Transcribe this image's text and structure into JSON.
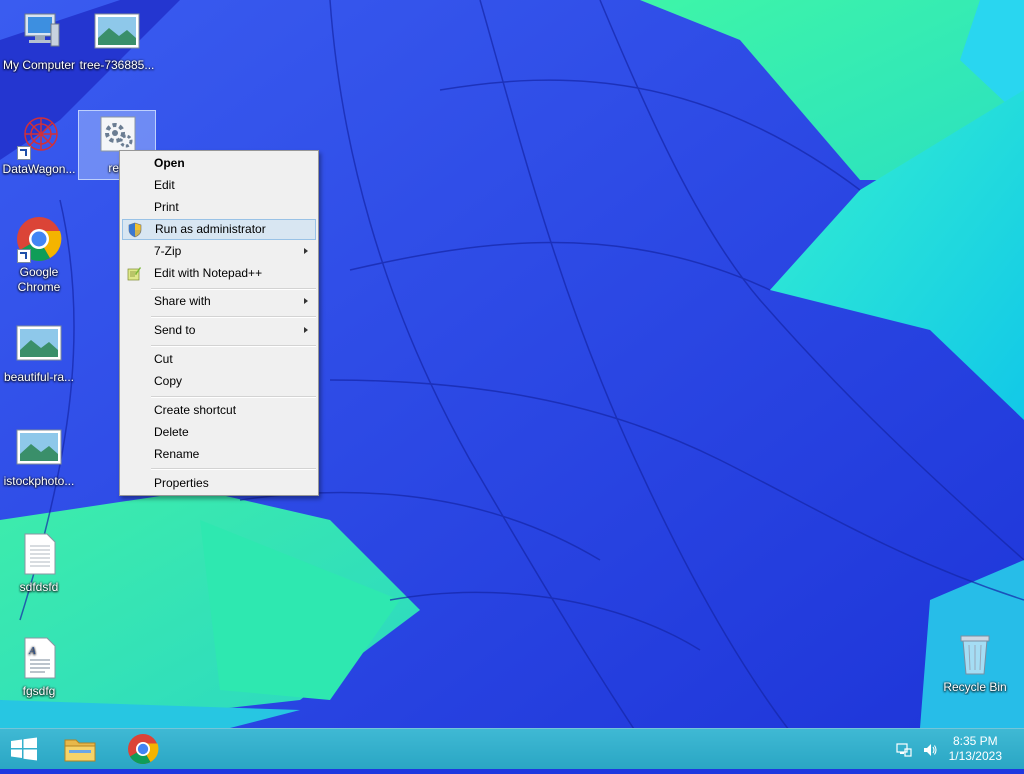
{
  "desktop": {
    "icons": [
      {
        "label": "My Computer"
      },
      {
        "label": "tree-736885..."
      },
      {
        "label": "DataWagon..."
      },
      {
        "label": "reb"
      },
      {
        "label": "Google Chrome"
      },
      {
        "label": "beautiful-ra..."
      },
      {
        "label": "istockphoto..."
      },
      {
        "label": "sdfdsfd"
      },
      {
        "label": "fgsdfg"
      },
      {
        "label": "Recycle Bin"
      }
    ]
  },
  "context_menu": {
    "items": [
      {
        "label": "Open"
      },
      {
        "label": "Edit"
      },
      {
        "label": "Print"
      },
      {
        "label": "Run as administrator"
      },
      {
        "label": "7-Zip"
      },
      {
        "label": "Edit with Notepad++"
      },
      {
        "label": "Share with"
      },
      {
        "label": "Send to"
      },
      {
        "label": "Cut"
      },
      {
        "label": "Copy"
      },
      {
        "label": "Create shortcut"
      },
      {
        "label": "Delete"
      },
      {
        "label": "Rename"
      },
      {
        "label": "Properties"
      }
    ]
  },
  "taskbar": {
    "time": "8:35 PM",
    "date": "1/13/2023",
    "pinned": [
      {
        "icon": "windows-start-icon"
      },
      {
        "icon": "file-explorer-icon"
      },
      {
        "icon": "chrome-icon"
      }
    ]
  },
  "colors": {
    "highlight": "#d8e6f2",
    "taskbar": "#2aa6c4",
    "wallpaper_blue": "#2848e8",
    "wallpaper_teal": "#28e8c8"
  }
}
